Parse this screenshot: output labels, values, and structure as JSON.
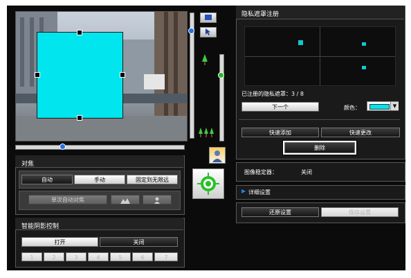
{
  "privacy_mask": {
    "title": "隐私遮罩注册",
    "registered_label": "已注册的隐私遮罩：3 / 8",
    "next_button": "下一个",
    "color_label": "颜色：",
    "color_value": "#00e5ee",
    "quick_add_button": "快速添加",
    "quick_change_button": "快速更改",
    "delete_button": "删除"
  },
  "stabilizer": {
    "label": "图像稳定器：",
    "value": "关闭"
  },
  "details": {
    "arrow": "▶",
    "label": "详细设置"
  },
  "settings": {
    "restore_button": "还原设置",
    "save_button": "保存设置"
  },
  "focus": {
    "title": "对焦",
    "auto": "自动",
    "manual": "手动",
    "fixed_infinity": "固定到无限远",
    "one_shot_af": "单次自动对焦",
    "selected": "自动"
  },
  "shadow_control": {
    "title": "智能阴影控制",
    "on": "打开",
    "off": "关闭",
    "selected": "关闭",
    "levels": [
      "1",
      "2",
      "3",
      "4",
      "5",
      "6",
      "7"
    ]
  },
  "icons": {
    "mask_tool": "mask-draw-icon",
    "pointer_tool": "pointer-icon",
    "single_tree": "tree-single-icon",
    "multi_tree": "tree-multi-icon",
    "person": "person-backlight-icon",
    "target": "target-icon",
    "dropdown": "▼"
  }
}
